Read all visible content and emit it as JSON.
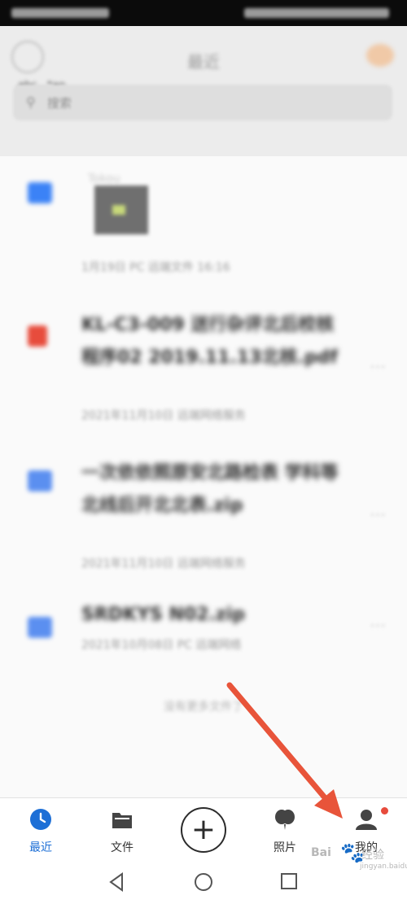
{
  "status_bar": {},
  "header": {
    "title": "最近",
    "user_label": "abc...*an"
  },
  "search": {
    "placeholder": "搜索"
  },
  "files": [
    {
      "name": "Tokou",
      "meta": "1月19日  PC 远端文件  16:16",
      "icon": "image-file-icon",
      "icon_color": "#3b82f6"
    },
    {
      "name": "KL-C3-009 送行杂评北后校核程序02 2019.11.13北核.pdf",
      "meta": "2021年11月10日  远端网络服务",
      "icon": "pdf-file-icon",
      "icon_color": "#e74c3c"
    },
    {
      "name": "一次依依照原安北路检表 学科等北线后开北北表.zip",
      "meta": "2021年11月10日  远端网络服务",
      "icon": "zip-file-icon",
      "icon_color": "#5b8ff0"
    },
    {
      "name": "SRDKYS N02.zip",
      "meta": "2021年10月08日  PC 远端网络",
      "icon": "zip-file-icon",
      "icon_color": "#5b8ff0"
    }
  ],
  "end_note": "没有更多文件了",
  "tabbar": {
    "recent": "最近",
    "files": "文件",
    "photos": "照片",
    "mine": "我的",
    "active_color": "#1d6fd6",
    "badge_color": "#e74b3c"
  },
  "annotation": {
    "arrow_color": "#e8543a"
  },
  "watermark": {
    "brand": "Bai",
    "paw": "🐾",
    "cn": "经验",
    "url": "jingyan.baidu.com"
  }
}
